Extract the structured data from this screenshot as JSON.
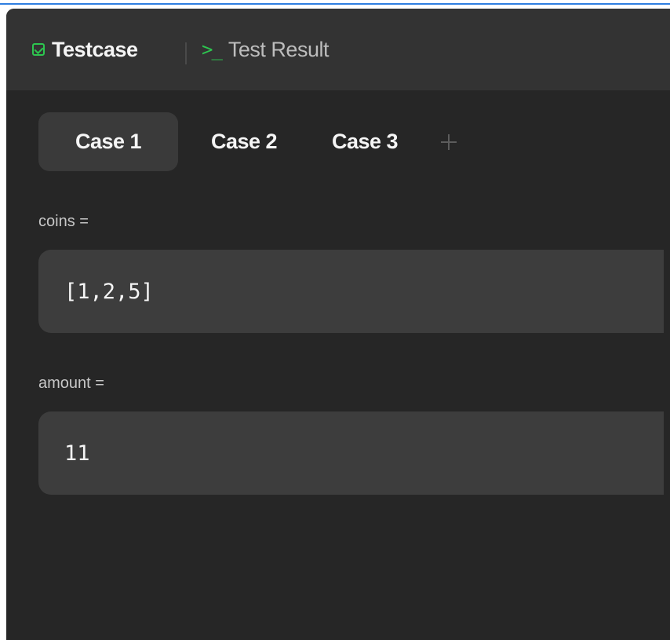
{
  "header": {
    "tabs": [
      {
        "label": "Testcase",
        "icon": "checkbox-icon",
        "active": true
      },
      {
        "label": "Test Result",
        "icon": "terminal-icon",
        "active": false
      }
    ]
  },
  "cases": {
    "tabs": [
      {
        "label": "Case 1",
        "selected": true
      },
      {
        "label": "Case 2",
        "selected": false
      },
      {
        "label": "Case 3",
        "selected": false
      }
    ],
    "add_icon": "plus-icon"
  },
  "params": [
    {
      "label": "coins =",
      "value": "[1,2,5]"
    },
    {
      "label": "amount =",
      "value": "11"
    }
  ],
  "colors": {
    "accent_green": "#2dc54f",
    "panel_bg": "#262626",
    "header_bg": "#333333",
    "field_bg": "#3d3d3d",
    "selected_tab_bg": "#3a3a3a"
  }
}
